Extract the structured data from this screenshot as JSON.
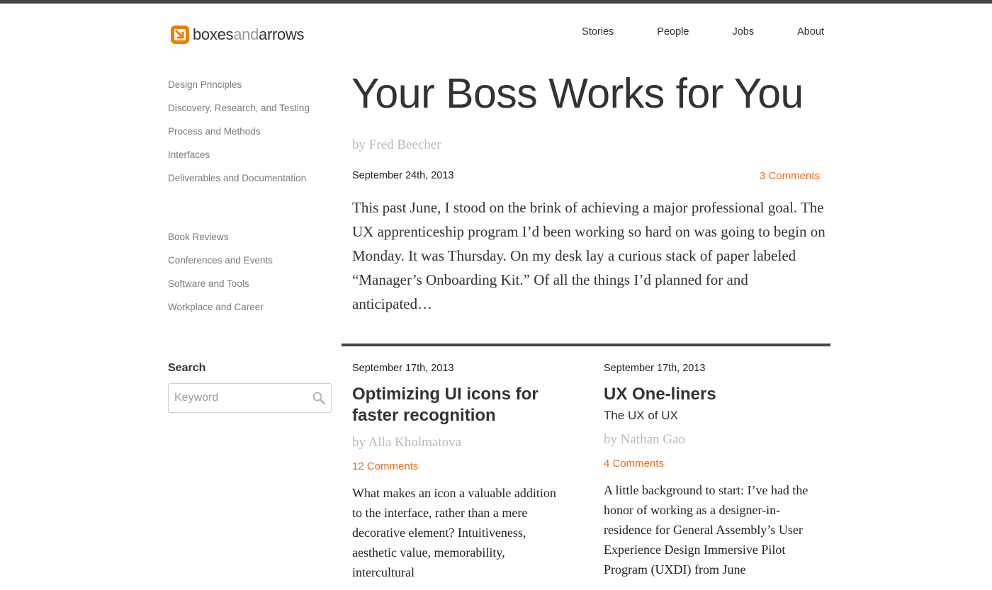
{
  "brand": {
    "logo_bold_1": "boxes",
    "logo_light": "and",
    "logo_bold_2": "arrows",
    "accent_color": "#f07d00"
  },
  "nav": {
    "items": [
      {
        "label": "Stories"
      },
      {
        "label": "People"
      },
      {
        "label": "Jobs"
      },
      {
        "label": "About"
      }
    ]
  },
  "sidebar": {
    "categories_1": [
      {
        "label": "Design Principles"
      },
      {
        "label": "Discovery, Research, and Testing"
      },
      {
        "label": "Process and Methods"
      },
      {
        "label": "Interfaces"
      },
      {
        "label": "Deliverables and Documentation"
      }
    ],
    "categories_2": [
      {
        "label": "Book Reviews"
      },
      {
        "label": "Conferences and Events"
      },
      {
        "label": "Software and Tools"
      },
      {
        "label": "Workplace and Career"
      }
    ],
    "search": {
      "heading": "Search",
      "placeholder": "Keyword",
      "icon": "search-icon"
    }
  },
  "featured": {
    "title": "Your Boss Works for You",
    "byline": "by Fred Beecher",
    "date": "September 24th, 2013",
    "comments": "3 Comments",
    "excerpt": "This past June, I stood on the brink of achieving a major professional goal. The UX apprenticeship program I’d been working so hard on was going to begin on Monday. It was Thursday. On my desk lay a curious stack of paper labeled “Manager’s Onboarding Kit.” Of all the things I’d planned for and anticipated…"
  },
  "articles": [
    {
      "date": "September 17th, 2013",
      "title": "Optimizing UI icons for faster recognition",
      "subtitle": "",
      "byline": "by Alla Kholmatova",
      "comments": "12 Comments",
      "excerpt": "What makes an icon a valuable addition to the interface, rather than a mere decorative element? Intuitiveness, aesthetic value, memorability, intercultural"
    },
    {
      "date": "September 17th, 2013",
      "title": "UX One-liners",
      "subtitle": "The UX of UX",
      "byline": "by Nathan Gao",
      "comments": "4 Comments",
      "excerpt": "A little background to start: I’ve had the honor of working as a designer-in-residence for General Assembly’s User Experience Design Immersive Pilot Program (UXDI) from June"
    }
  ],
  "colors": {
    "link": "#f06a0f",
    "rule": "#444444"
  }
}
